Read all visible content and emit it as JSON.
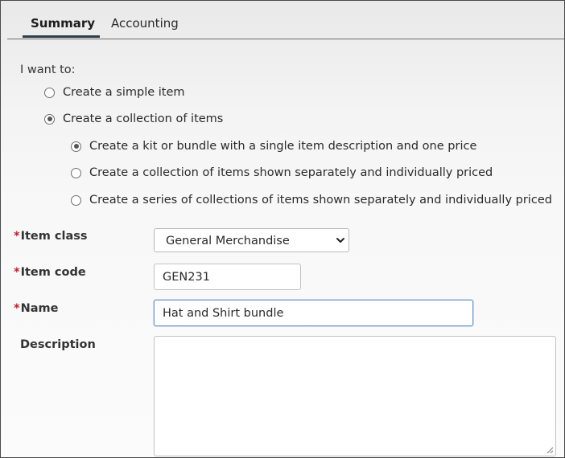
{
  "tabs": [
    {
      "label": "Summary",
      "active": true
    },
    {
      "label": "Accounting",
      "active": false
    }
  ],
  "item_type": {
    "prompt": "I want to:",
    "options": [
      {
        "label": "Create a simple item",
        "checked": false
      },
      {
        "label": "Create a collection of items",
        "checked": true
      }
    ],
    "collection_options": [
      {
        "label": "Create a kit or bundle with a single item description and one price",
        "checked": true
      },
      {
        "label": "Create a collection of items shown separately and individually priced",
        "checked": false
      },
      {
        "label": "Create a series of collections of items shown separately and individually priced",
        "checked": false
      }
    ]
  },
  "form": {
    "required_marker": "*",
    "item_class": {
      "label": "Item class",
      "value": "General Merchandise"
    },
    "item_code": {
      "label": "Item code",
      "value": "GEN231"
    },
    "name": {
      "label": "Name",
      "value": "Hat and Shirt bundle"
    },
    "description": {
      "label": "Description",
      "value": ""
    }
  },
  "colors": {
    "required": "#c0202a",
    "tab_underline": "#2d3e4a",
    "focus_border": "#6d96c6"
  },
  "icons": {
    "select_arrow": "chevron-down-icon",
    "textarea_resize": "resize-grip-icon"
  }
}
